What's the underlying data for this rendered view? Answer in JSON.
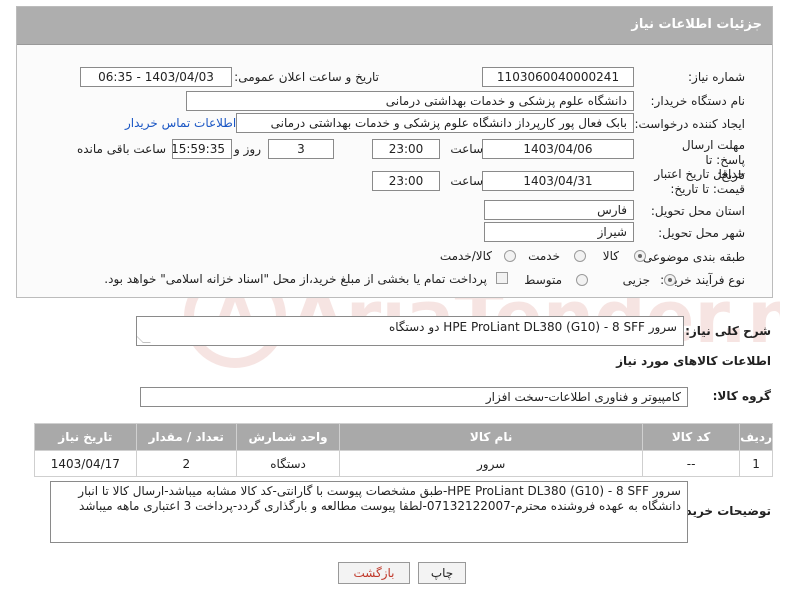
{
  "header": {
    "title": "جزئیات اطلاعات نیاز"
  },
  "fields": {
    "need_number_label": "شماره نیاز:",
    "need_number": "1103060040000241",
    "announce_label": "تاریخ و ساعت اعلان عمومی:",
    "announce_value": "1403/04/03 - 06:35",
    "buyer_org_label": "نام دستگاه خریدار:",
    "buyer_org": "دانشگاه علوم پزشکی و خدمات بهداشتی درمانی",
    "creator_label": "ایجاد کننده درخواست:",
    "creator": "بابک فعال پور کارپرداز دانشگاه علوم پزشکی و خدمات بهداشتی درمانی",
    "contact_link": "اطلاعات تماس خریدار",
    "deadline_label": "مهلت ارسال پاسخ: تا تاریخ:",
    "deadline_date": "1403/04/06",
    "time_label": "ساعت",
    "deadline_time": "23:00",
    "days_value": "3",
    "days_label": "روز و",
    "remaining_time": "15:59:35",
    "remaining_label": "ساعت باقی مانده",
    "validity_label": "حداقل تاریخ اعتبار قیمت: تا تاریخ:",
    "validity_date": "1403/04/31",
    "validity_time": "23:00",
    "province_label": "استان محل تحویل:",
    "province": "فارس",
    "city_label": "شهر محل تحویل:",
    "city": "شیراز",
    "category_label": "طبقه بندی موضوعی:",
    "category_options": [
      "کالا",
      "خدمت",
      "کالا/خدمت"
    ],
    "process_label": "نوع فرآیند خرید :",
    "process_options": [
      "جزیی",
      "متوسط"
    ],
    "payment_note": "پرداخت تمام یا بخشی از مبلغ خرید،از محل \"اسناد خزانه اسلامی\" خواهد بود."
  },
  "summary": {
    "label": "شرح کلی نیاز:",
    "text": "سرور HPE ProLiant DL380 (G10) - 8 SFF دو دستگاه"
  },
  "goods_section_title": "اطلاعات کالاهای مورد نیاز",
  "goods_group": {
    "label": "گروه کالا:",
    "value": "کامپیوتر و فناوری اطلاعات-سخت افزار"
  },
  "table": {
    "headers": [
      "ردیف",
      "کد کالا",
      "نام کالا",
      "واحد شمارش",
      "تعداد / مقدار",
      "تاریخ نیاز"
    ],
    "rows": [
      [
        "1",
        "--",
        "سرور",
        "دستگاه",
        "2",
        "1403/04/17"
      ]
    ]
  },
  "buyer_notes": {
    "label": "توضیحات خریدار:",
    "text": "سرور HPE ProLiant DL380 (G10) - 8 SFF-طبق مشخصات پیوست با گارانتی-کد کالا مشابه میباشد-ارسال کالا تا انبار دانشگاه به عهده فروشنده محترم-07132122007-لطفا پیوست مطالعه و بارگذاری گردد-پرداخت 3 اعتباری ماهه میباشد"
  },
  "buttons": {
    "print": "چاپ",
    "back": "بازگشت"
  },
  "watermark": "AriaTender.neT",
  "colors": {
    "header_bg": "#aeaeae",
    "link": "#1a56c4",
    "back_button_text": "#c0392b"
  }
}
